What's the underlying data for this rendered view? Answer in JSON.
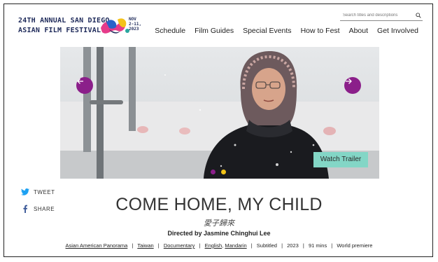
{
  "logo": {
    "line1": "24TH ANNUAL SAN DIEGO",
    "line2": "ASIAN FILM FESTIVAL",
    "dates_month": "NOV",
    "dates_days": "2-11,",
    "dates_year": "2023"
  },
  "search": {
    "placeholder": "Search titles and descriptions"
  },
  "nav": {
    "items": [
      "Schedule",
      "Film Guides",
      "Special Events",
      "How to Fest",
      "About",
      "Get Involved"
    ]
  },
  "hero": {
    "trailer_label": "Watch Trailer",
    "dot_colors": [
      "#8b1f8a",
      "#f2c318"
    ],
    "accent": "#8b1f8a"
  },
  "social": {
    "tweet": "TWEET",
    "share": "SHARE"
  },
  "film": {
    "title": "COME HOME, MY CHILD",
    "subtitle": "愛子歸來",
    "director": "Directed by Jasmine Chinghui Lee",
    "meta": {
      "program": "Asian American Panorama",
      "country": "Taiwan",
      "genre": "Documentary",
      "lang1": "English",
      "lang2": "Mandarin",
      "subtitled": "Subtitled",
      "year": "2023",
      "runtime": "91 mins",
      "premiere": "World premiere",
      "sep": "|",
      "comma": ","
    }
  }
}
